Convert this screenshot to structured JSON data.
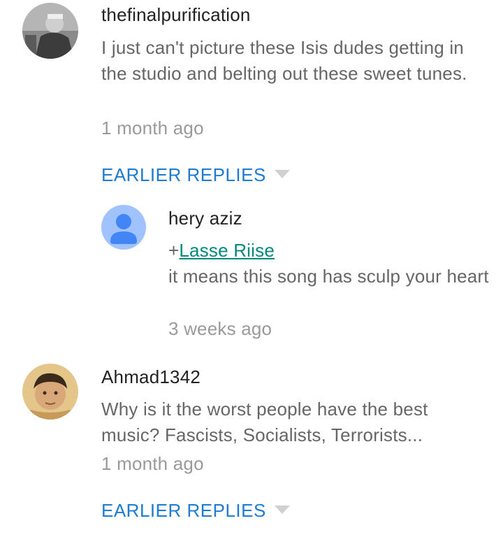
{
  "comments": [
    {
      "author": "thefinalpurification",
      "text": "I just can't picture these Isis dudes getting in the studio and belting out these sweet tunes.",
      "time": "1 month ago",
      "earlier_replies_label": "EARLIER REPLIES"
    },
    {
      "author": "Ahmad1342",
      "text": "Why is it the worst people have the best music? Fascists, Socialists, Terrorists...",
      "time": "1 month ago",
      "earlier_replies_label": "EARLIER REPLIES"
    }
  ],
  "reply": {
    "author": "hery aziz",
    "mention_prefix": "+",
    "mention_name": "Lasse Riise",
    "text": "it means this song has sculp your heart",
    "time": "3 weeks ago"
  },
  "colors": {
    "author": "#222222",
    "body": "#666666",
    "time": "#9a9a9a",
    "link_blue": "#1e7bd4",
    "mention_teal": "#00897b",
    "default_avatar_bg": "#a0c3ff",
    "default_avatar_fg": "#4285f4"
  },
  "icons": {
    "expand": "chevron-down-icon",
    "default_avatar": "person-icon"
  }
}
